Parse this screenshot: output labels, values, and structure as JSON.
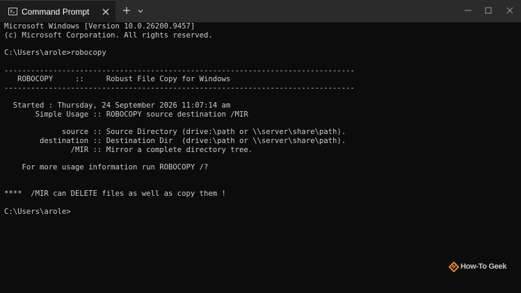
{
  "tab": {
    "title": "Command Prompt",
    "icon": "terminal-icon"
  },
  "titlebar": {
    "new_tab_icon": "plus-icon",
    "dropdown_icon": "chevron-down-icon",
    "minimize_icon": "minimize-icon",
    "maximize_icon": "maximize-icon",
    "close_icon": "close-icon"
  },
  "terminal": {
    "lines": [
      "Microsoft Windows [Version 10.0.26200.9457]",
      "(c) Microsoft Corporation. All rights reserved.",
      "",
      "C:\\Users\\arole>robocopy",
      "",
      "-------------------------------------------------------------------------------",
      "   ROBOCOPY     ::     Robust File Copy for Windows",
      "-------------------------------------------------------------------------------",
      "",
      "  Started : Thursday, 24 September 2026 11:07:14 am",
      "       Simple Usage :: ROBOCOPY source destination /MIR",
      "",
      "             source :: Source Directory (drive:\\path or \\\\server\\share\\path).",
      "        destination :: Destination Dir  (drive:\\path or \\\\server\\share\\path).",
      "               /MIR :: Mirror a complete directory tree.",
      "",
      "    For more usage information run ROBOCOPY /?",
      "",
      "",
      "****  /MIR can DELETE files as well as copy them !",
      "",
      "C:\\Users\\arole>"
    ]
  },
  "watermark": {
    "text": "How-To Geek",
    "icon": "htg-logo-icon",
    "color": "#e88b1a"
  }
}
